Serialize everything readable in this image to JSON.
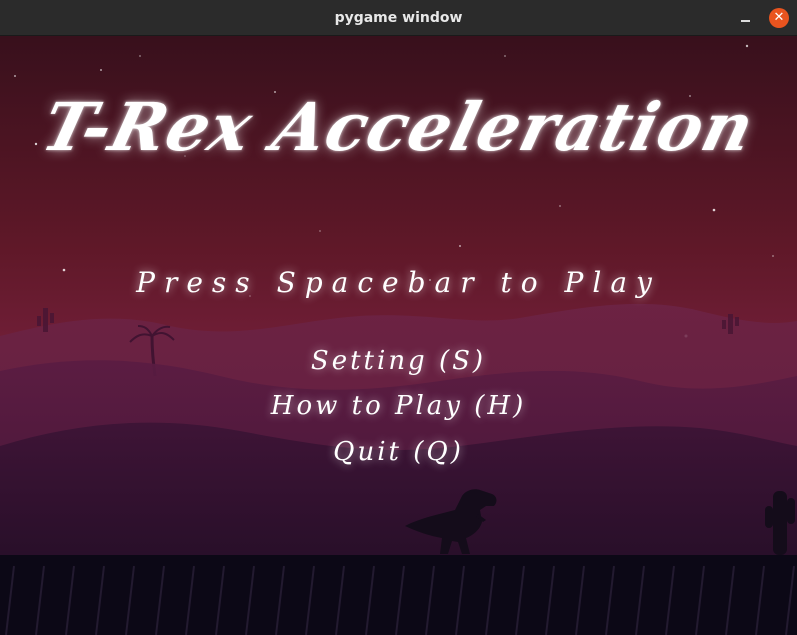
{
  "window": {
    "title": "pygame window",
    "minimize_icon": "minimize-icon",
    "close_icon": "close-icon",
    "close_glyph": "✕"
  },
  "game": {
    "title": "T-Rex Acceleration",
    "prompt": "Press Spacebar to Play",
    "menu": {
      "setting": "Setting (S)",
      "how_to_play": "How to Play (H)",
      "quit": "Quit (Q)"
    }
  },
  "colors": {
    "sky_top": "#3a0f1c",
    "sky_mid": "#6a1a2c",
    "sky_low": "#7a2340",
    "hill_far": "#5a1c3a",
    "hill_mid": "#4a1636",
    "hill_near": "#35112e",
    "ground": "#0c0816",
    "silhouette": "#140c1a",
    "accent_close": "#e9541f"
  }
}
